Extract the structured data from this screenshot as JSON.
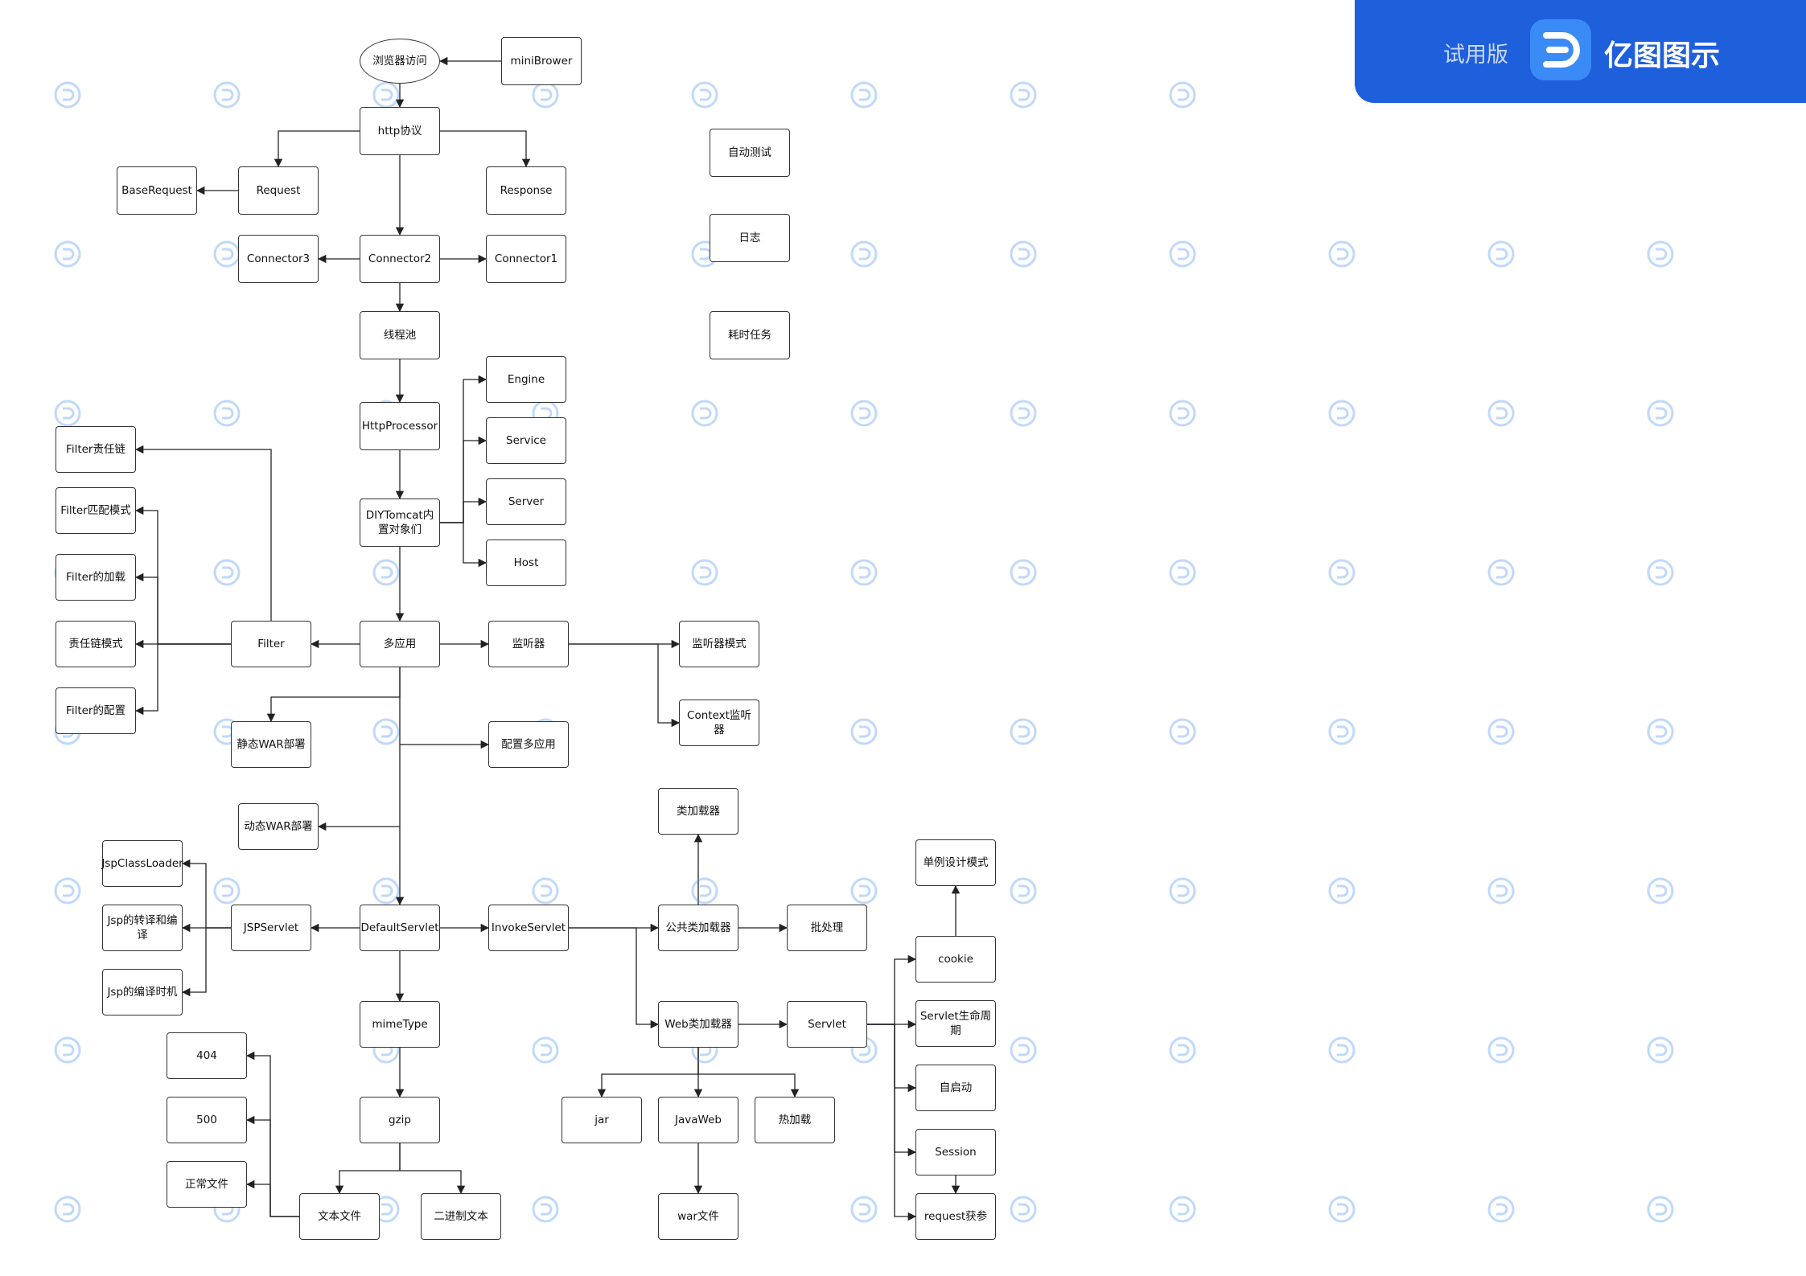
{
  "banner": {
    "trial_label": "试用版",
    "brand_name": "亿图图示",
    "logo_icon": "edraw-logo-icon",
    "color": "#1e5fdc"
  },
  "watermark": {
    "icon": "edraw-watermark-icon",
    "text": "亿图图示"
  },
  "diagram": {
    "nodes": [
      {
        "id": "browser",
        "label": "浏览器访问",
        "shape": "ellipse"
      },
      {
        "id": "miniBrower",
        "label": "miniBrower"
      },
      {
        "id": "http",
        "label": "http协议"
      },
      {
        "id": "baseRequest",
        "label": "BaseRequest"
      },
      {
        "id": "request",
        "label": "Request"
      },
      {
        "id": "response",
        "label": "Response"
      },
      {
        "id": "connector3",
        "label": "Connector3"
      },
      {
        "id": "connector2",
        "label": "Connector2"
      },
      {
        "id": "connector1",
        "label": "Connector1"
      },
      {
        "id": "threadPool",
        "label": "线程池"
      },
      {
        "id": "httpProcessor",
        "label": "HttpProcessor"
      },
      {
        "id": "engine",
        "label": "Engine"
      },
      {
        "id": "service",
        "label": "Service"
      },
      {
        "id": "server",
        "label": "Server"
      },
      {
        "id": "host",
        "label": "Host"
      },
      {
        "id": "diyTomcat",
        "label": "DIYTomcat内\n置对象们"
      },
      {
        "id": "autoTest",
        "label": "自动测试"
      },
      {
        "id": "log",
        "label": "日志"
      },
      {
        "id": "longTask",
        "label": "耗时任务"
      },
      {
        "id": "filterChain",
        "label": "Filter责任链"
      },
      {
        "id": "filterMatch",
        "label": "Filter匹配模式"
      },
      {
        "id": "filterLoad",
        "label": "Filter的加载"
      },
      {
        "id": "chainPattern",
        "label": "责任链模式"
      },
      {
        "id": "filterConfig",
        "label": "Filter的配置"
      },
      {
        "id": "filter",
        "label": "Filter"
      },
      {
        "id": "multiApp",
        "label": "多应用"
      },
      {
        "id": "listener",
        "label": "监听器"
      },
      {
        "id": "listenerPattern",
        "label": "监听器模式"
      },
      {
        "id": "contextListener",
        "label": "Context监听器"
      },
      {
        "id": "staticWar",
        "label": "静态WAR部署"
      },
      {
        "id": "configMulti",
        "label": "配置多应用"
      },
      {
        "id": "dynamicWar",
        "label": "动态WAR部署"
      },
      {
        "id": "classLoader",
        "label": "类加载器"
      },
      {
        "id": "jspClassLoader",
        "label": "JspClassLoader"
      },
      {
        "id": "jspTranslate",
        "label": "Jsp的转译和编\n译"
      },
      {
        "id": "jspCompileTime",
        "label": "Jsp的编译时机"
      },
      {
        "id": "jspServlet",
        "label": "JSPServlet"
      },
      {
        "id": "defaultServlet",
        "label": "DefaultServlet"
      },
      {
        "id": "invokeServlet",
        "label": "InvokeServlet"
      },
      {
        "id": "commonLoader",
        "label": "公共类加载器"
      },
      {
        "id": "batch",
        "label": "批处理"
      },
      {
        "id": "singleton",
        "label": "单例设计模式"
      },
      {
        "id": "cookie",
        "label": "cookie"
      },
      {
        "id": "mimeType",
        "label": "mimeType"
      },
      {
        "id": "webLoader",
        "label": "Web类加载器"
      },
      {
        "id": "servlet",
        "label": "Servlet"
      },
      {
        "id": "servletLife",
        "label": "Servlet生命周\n期"
      },
      {
        "id": "autoStart",
        "label": "自启动"
      },
      {
        "id": "session",
        "label": "Session"
      },
      {
        "id": "requestParam",
        "label": "request获参"
      },
      {
        "id": "e404",
        "label": "404"
      },
      {
        "id": "e500",
        "label": "500"
      },
      {
        "id": "normalFile",
        "label": "正常文件"
      },
      {
        "id": "gzip",
        "label": "gzip"
      },
      {
        "id": "textFile",
        "label": "文本文件"
      },
      {
        "id": "binaryText",
        "label": "二进制文本"
      },
      {
        "id": "jar",
        "label": "jar"
      },
      {
        "id": "javaWeb",
        "label": "JavaWeb"
      },
      {
        "id": "hotLoad",
        "label": "热加载"
      },
      {
        "id": "warFile",
        "label": "war文件"
      }
    ],
    "edges": [
      {
        "from": "miniBrower",
        "to": "browser"
      },
      {
        "from": "browser",
        "to": "http"
      },
      {
        "from": "http",
        "to": "request"
      },
      {
        "from": "http",
        "to": "response"
      },
      {
        "from": "request",
        "to": "baseRequest"
      },
      {
        "from": "http",
        "to": "connector2"
      },
      {
        "from": "connector2",
        "to": "connector3"
      },
      {
        "from": "connector2",
        "to": "connector1"
      },
      {
        "from": "connector2",
        "to": "threadPool"
      },
      {
        "from": "threadPool",
        "to": "httpProcessor"
      },
      {
        "from": "httpProcessor",
        "to": "diyTomcat"
      },
      {
        "from": "diyTomcat",
        "to": "engine"
      },
      {
        "from": "diyTomcat",
        "to": "service"
      },
      {
        "from": "diyTomcat",
        "to": "server"
      },
      {
        "from": "diyTomcat",
        "to": "host"
      },
      {
        "from": "diyTomcat",
        "to": "multiApp"
      },
      {
        "from": "multiApp",
        "to": "filter"
      },
      {
        "from": "filter",
        "to": "filterChain"
      },
      {
        "from": "filter",
        "to": "chainPattern"
      },
      {
        "from": "filter",
        "to": "filterMatch"
      },
      {
        "from": "filter",
        "to": "filterLoad"
      },
      {
        "from": "filter",
        "to": "filterConfig"
      },
      {
        "from": "multiApp",
        "to": "listener"
      },
      {
        "from": "listener",
        "to": "listenerPattern"
      },
      {
        "from": "listener",
        "to": "contextListener"
      },
      {
        "from": "multiApp",
        "to": "staticWar"
      },
      {
        "from": "multiApp",
        "to": "configMulti"
      },
      {
        "from": "multiApp",
        "to": "dynamicWar"
      },
      {
        "from": "multiApp",
        "to": "defaultServlet"
      },
      {
        "from": "defaultServlet",
        "to": "jspServlet"
      },
      {
        "from": "jspServlet",
        "to": "jspTranslate"
      },
      {
        "from": "jspServlet",
        "to": "jspClassLoader"
      },
      {
        "from": "jspServlet",
        "to": "jspCompileTime"
      },
      {
        "from": "defaultServlet",
        "to": "invokeServlet"
      },
      {
        "from": "invokeServlet",
        "to": "commonLoader"
      },
      {
        "from": "invokeServlet",
        "to": "webLoader"
      },
      {
        "from": "commonLoader",
        "to": "classLoader"
      },
      {
        "from": "commonLoader",
        "to": "batch"
      },
      {
        "from": "webLoader",
        "to": "servlet"
      },
      {
        "from": "webLoader",
        "to": "jar"
      },
      {
        "from": "webLoader",
        "to": "javaWeb"
      },
      {
        "from": "webLoader",
        "to": "hotLoad"
      },
      {
        "from": "javaWeb",
        "to": "warFile"
      },
      {
        "from": "servlet",
        "to": "cookie"
      },
      {
        "from": "servlet",
        "to": "servletLife"
      },
      {
        "from": "servlet",
        "to": "autoStart"
      },
      {
        "from": "servlet",
        "to": "session"
      },
      {
        "from": "servlet",
        "to": "requestParam"
      },
      {
        "from": "cookie",
        "to": "singleton"
      },
      {
        "from": "session",
        "to": "requestParam"
      },
      {
        "from": "defaultServlet",
        "to": "mimeType"
      },
      {
        "from": "mimeType",
        "to": "gzip"
      },
      {
        "from": "gzip",
        "to": "textFile"
      },
      {
        "from": "gzip",
        "to": "binaryText"
      },
      {
        "from": "textFile",
        "to": "e404"
      },
      {
        "from": "textFile",
        "to": "e500"
      },
      {
        "from": "textFile",
        "to": "normalFile"
      }
    ]
  }
}
